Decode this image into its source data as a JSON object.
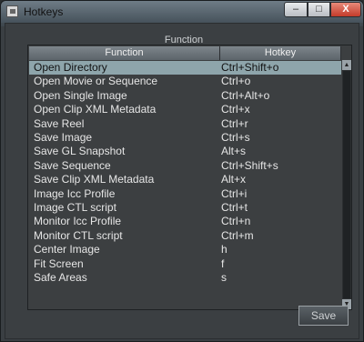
{
  "window": {
    "title": "Hotkeys"
  },
  "controls": {
    "minimize": "–",
    "maximize": "□",
    "close": "X"
  },
  "group_label": "Function",
  "table": {
    "columns": [
      "Function",
      "Hotkey"
    ],
    "selected_index": 0,
    "rows": [
      {
        "function": "Open Directory",
        "hotkey": "Ctrl+Shift+o"
      },
      {
        "function": "Open Movie or Sequence",
        "hotkey": "Ctrl+o"
      },
      {
        "function": "Open Single Image",
        "hotkey": "Ctrl+Alt+o"
      },
      {
        "function": "Open Clip XML Metadata",
        "hotkey": "Ctrl+x"
      },
      {
        "function": "Save Reel",
        "hotkey": "Ctrl+r"
      },
      {
        "function": "Save Image",
        "hotkey": "Ctrl+s"
      },
      {
        "function": "Save GL Snapshot",
        "hotkey": "Alt+s"
      },
      {
        "function": "Save Sequence",
        "hotkey": "Ctrl+Shift+s"
      },
      {
        "function": "Save Clip XML Metadata",
        "hotkey": "Alt+x"
      },
      {
        "function": "Image Icc Profile",
        "hotkey": "Ctrl+i"
      },
      {
        "function": "Image CTL script",
        "hotkey": "Ctrl+t"
      },
      {
        "function": "Monitor Icc Profile",
        "hotkey": "Ctrl+n"
      },
      {
        "function": "Monitor CTL script",
        "hotkey": "Ctrl+m"
      },
      {
        "function": "Center Image",
        "hotkey": "h"
      },
      {
        "function": "Fit Screen",
        "hotkey": "f"
      },
      {
        "function": "Safe Areas",
        "hotkey": "s"
      }
    ]
  },
  "buttons": {
    "save": "Save"
  }
}
